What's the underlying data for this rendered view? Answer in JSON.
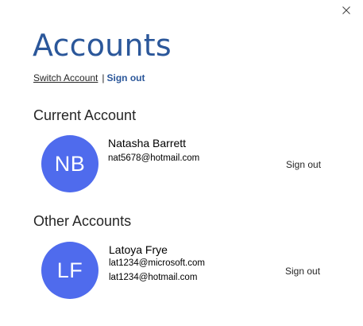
{
  "window": {
    "title": "Accounts",
    "close_icon": "close-icon"
  },
  "links": {
    "switch_account": "Switch Account",
    "separator": "|",
    "sign_out": "Sign out"
  },
  "current_account": {
    "heading": "Current Account",
    "initials": "NB",
    "name": "Natasha Barrett",
    "emails": [
      "nat5678@hotmail.com"
    ],
    "sign_out": "Sign out"
  },
  "other_accounts": {
    "heading": "Other Accounts",
    "items": [
      {
        "initials": "LF",
        "name": "Latoya Frye",
        "emails": [
          "lat1234@microsoft.com",
          "lat1234@hotmail.com"
        ],
        "sign_out": "Sign out"
      }
    ]
  },
  "colors": {
    "accent": "#2b579a",
    "avatar": "#4f6bed",
    "text": "#262626"
  }
}
